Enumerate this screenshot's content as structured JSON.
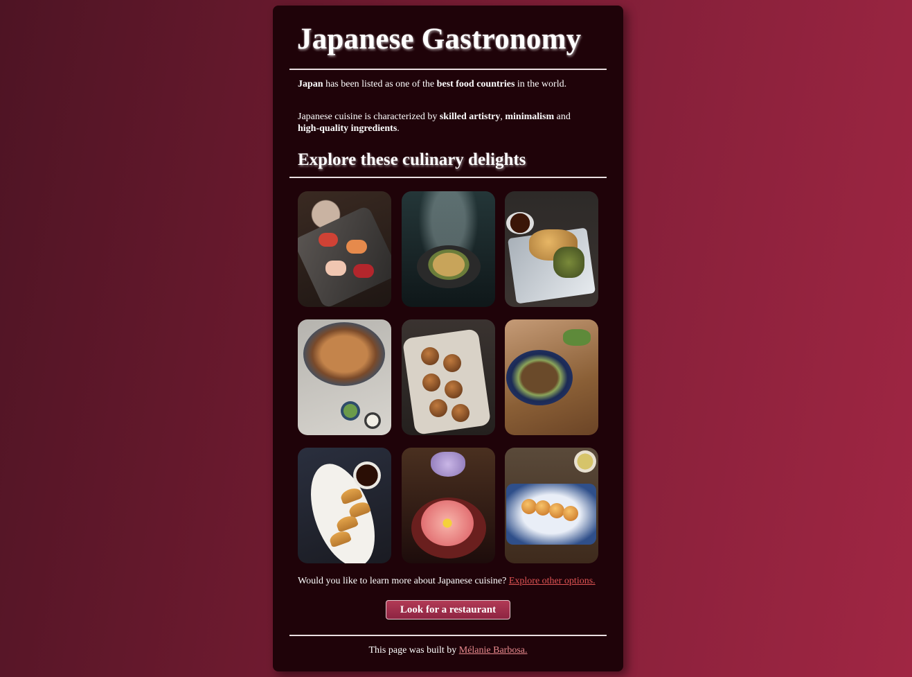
{
  "header": {
    "title": "Japanese Gastronomy"
  },
  "intro": {
    "p1_strong1": "Japan",
    "p1_text1": " has been listed as one of the ",
    "p1_strong2": "best food countries",
    "p1_text2": " in the world.",
    "p2_text1": "Japanese cuisine is characterized by ",
    "p2_strong1": "skilled artistry",
    "p2_text2": ", ",
    "p2_strong2": "minimalism",
    "p2_text3": " and ",
    "p2_strong3": "high-quality ingredients",
    "p2_text4": "."
  },
  "gallery": {
    "title": "Explore these culinary delights"
  },
  "cta": {
    "question": "Would you like to learn more about Japanese cuisine? ",
    "link": "Explore other options.",
    "button": "Look for a restaurant"
  },
  "footer": {
    "text": "This page was built by ",
    "author": "Mélanie Barbosa."
  },
  "colors": {
    "card_background": "#1f0309",
    "link": "#e05454",
    "button": "#a3304c"
  }
}
